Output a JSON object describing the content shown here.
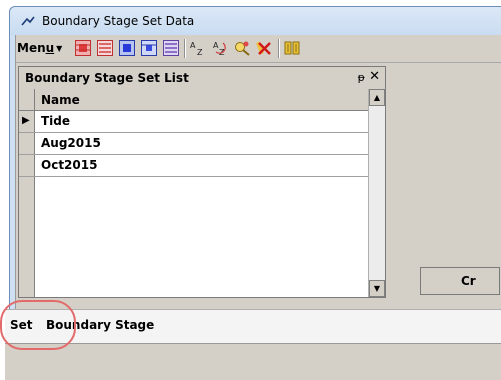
{
  "window": {
    "title": "Boundary Stage Set Data"
  },
  "toolbar": {
    "menu_label_prefix": "Men",
    "menu_label_underlined": "u",
    "icons": [
      "grid-red-icon",
      "list-red-icon",
      "grid-blue-icon",
      "grid-blue-alt-icon",
      "list-blue-icon",
      "sort-az-icon",
      "sort-az-refresh-icon",
      "find-icon",
      "delete-tools-icon",
      "split-icon"
    ]
  },
  "list_panel": {
    "title": "Boundary Stage Set List",
    "pin_glyph": "ᵽ",
    "close_glyph": "✕",
    "column_header": "Name",
    "rows": [
      {
        "name": "Tide",
        "current": true
      },
      {
        "name": "Aug2015",
        "current": false
      },
      {
        "name": "Oct2015",
        "current": false
      }
    ]
  },
  "create_button": {
    "label": "Cr"
  },
  "bottom_bar": {
    "set_label": "Set",
    "boundary_stage_label": "Boundary Stage"
  },
  "colors": {
    "highlight_ring": "#e36a6a",
    "titlebar": "#cfe0f3",
    "panel": "#d4d0c8"
  }
}
